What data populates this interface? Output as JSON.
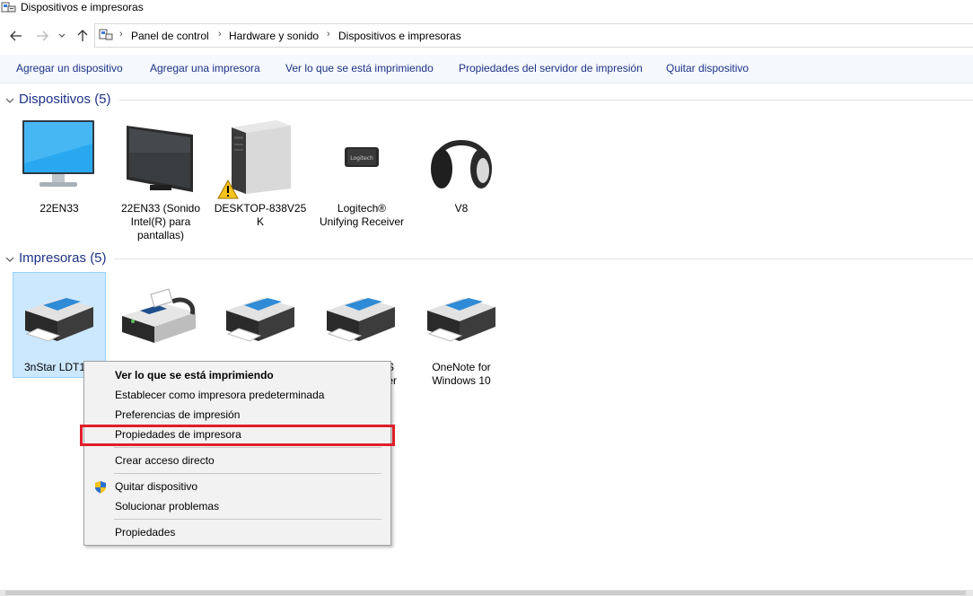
{
  "window": {
    "title": "Dispositivos e impresoras"
  },
  "address": {
    "crumbs": [
      "Panel de control",
      "Hardware y sonido",
      "Dispositivos e impresoras"
    ]
  },
  "toolbar": {
    "add_device": "Agregar un dispositivo",
    "add_printer": "Agregar una impresora",
    "see_printing": "Ver lo que se está imprimiendo",
    "server_props": "Propiedades del servidor de impresión",
    "remove_device": "Quitar dispositivo"
  },
  "devices": {
    "header": "Dispositivos (5)",
    "items": [
      {
        "icon": "monitor-icon",
        "label": "22EN33"
      },
      {
        "icon": "tv-monitor-icon",
        "label_lines": [
          "22EN33 (Sonido",
          "Intel(R) para",
          "pantallas)"
        ]
      },
      {
        "icon": "computer-tower-icon",
        "label_lines": [
          "DESKTOP-838V25",
          "K"
        ],
        "warning": true
      },
      {
        "icon": "usb-receiver-icon",
        "label_lines": [
          "Logitech®",
          "Unifying Receiver"
        ]
      },
      {
        "icon": "headphones-icon",
        "label": "V8"
      }
    ],
    "receiver_brand": "Logitech"
  },
  "printers": {
    "header": "Impresoras (5)",
    "items": [
      {
        "icon": "printer-icon",
        "label_visible": "3nStar LDT10",
        "selected": true
      },
      {
        "icon": "fax-icon"
      },
      {
        "icon": "printer-icon"
      },
      {
        "icon": "printer-icon",
        "label_visible_lines": [
          "S",
          "ter"
        ]
      },
      {
        "icon": "printer-icon",
        "label_lines": [
          "OneNote for",
          "Windows 10"
        ]
      }
    ]
  },
  "context_menu": {
    "items": [
      "Ver lo que se está imprimiendo",
      "Establecer como impresora predeterminada",
      "Preferencias de impresión",
      "Propiedades de impresora",
      "Crear acceso directo",
      "Quitar dispositivo",
      "Solucionar problemas",
      "Propiedades"
    ],
    "bold_index": 0,
    "highlighted_index": 3,
    "highlight_color": "#e01e2a"
  },
  "colors": {
    "link": "#1e3287",
    "selection_bg": "#cce8ff",
    "selection_border": "#99d1ff"
  }
}
